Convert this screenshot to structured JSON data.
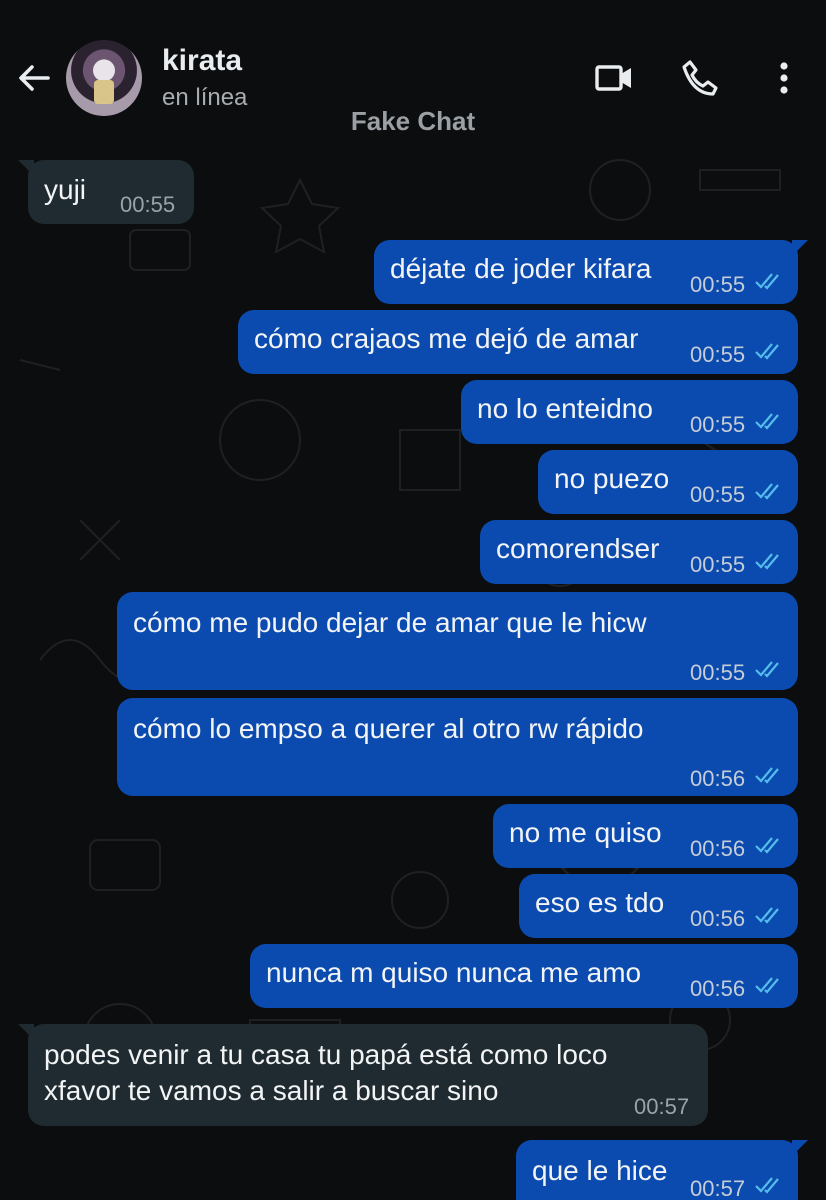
{
  "header": {
    "contact_name": "kirata",
    "contact_status": "en línea",
    "chat_label": "Fake Chat"
  },
  "colors": {
    "outgoing_bubble": "#0b4bb0",
    "incoming_bubble": "#1f2b30",
    "read_ticks": "#53bdeb",
    "background": "#0b0d0f"
  },
  "icons": {
    "back": "arrow-left-icon",
    "video": "video-camera-icon",
    "call": "phone-icon",
    "menu": "more-vertical-icon",
    "read": "double-check-icon"
  },
  "messages": [
    {
      "dir": "in",
      "text": "yuji",
      "time": "00:55"
    },
    {
      "dir": "out",
      "text": "déjate de joder kifara",
      "time": "00:55",
      "status": "read"
    },
    {
      "dir": "out",
      "text": "cómo crajaos me dejó de amar",
      "time": "00:55",
      "status": "read"
    },
    {
      "dir": "out",
      "text": "no lo enteidno",
      "time": "00:55",
      "status": "read"
    },
    {
      "dir": "out",
      "text": "no puezo",
      "time": "00:55",
      "status": "read"
    },
    {
      "dir": "out",
      "text": "comorendser",
      "time": "00:55",
      "status": "read"
    },
    {
      "dir": "out",
      "text": "cómo me pudo dejar de amar que le hicw",
      "time": "00:55",
      "status": "read"
    },
    {
      "dir": "out",
      "text": "cómo lo empso a querer al otro rw rápido",
      "time": "00:56",
      "status": "read"
    },
    {
      "dir": "out",
      "text": "no me quiso",
      "time": "00:56",
      "status": "read"
    },
    {
      "dir": "out",
      "text": "eso es tdo",
      "time": "00:56",
      "status": "read"
    },
    {
      "dir": "out",
      "text": "nunca m quiso nunca me amo",
      "time": "00:56",
      "status": "read"
    },
    {
      "dir": "in",
      "lines": [
        "podes venir a tu casa tu papá está como loco",
        "xfavor te vamos a salir a buscar sino"
      ],
      "time": "00:57"
    },
    {
      "dir": "out",
      "text": "que le hice",
      "time": "00:57",
      "status": "read"
    }
  ]
}
